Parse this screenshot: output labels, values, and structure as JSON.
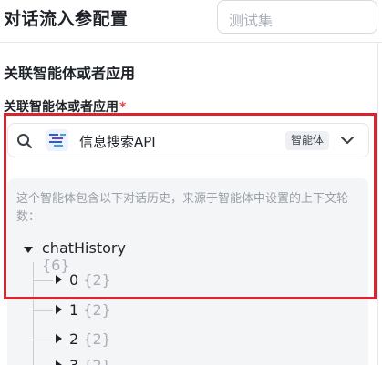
{
  "header": {
    "title": "对话流入参配置",
    "test_set_placeholder": "测试集"
  },
  "section": {
    "title": "关联智能体或者应用",
    "field_label": "关联智能体或者应用",
    "required_mark": "*"
  },
  "agent_select": {
    "icon": "search-icon",
    "name": "信息搜索API",
    "tag": "智能体",
    "dropdown_icon": "chevron-down-icon"
  },
  "history": {
    "description": "这个智能体包含以下对话历史，来源于智能体中设置的上下文轮数：",
    "root": {
      "name": "chatHistory",
      "count": "{6}"
    },
    "nodes": [
      {
        "name": "0",
        "count": "{2}"
      },
      {
        "name": "1",
        "count": "{2}"
      },
      {
        "name": "2",
        "count": "{2}"
      },
      {
        "name": "3",
        "count": "{2}"
      }
    ]
  },
  "colors": {
    "highlight_frame": "#d9262e",
    "required": "#e5484d",
    "panel_bg": "#f4f5f7",
    "muted_text": "#a9aeb8"
  }
}
